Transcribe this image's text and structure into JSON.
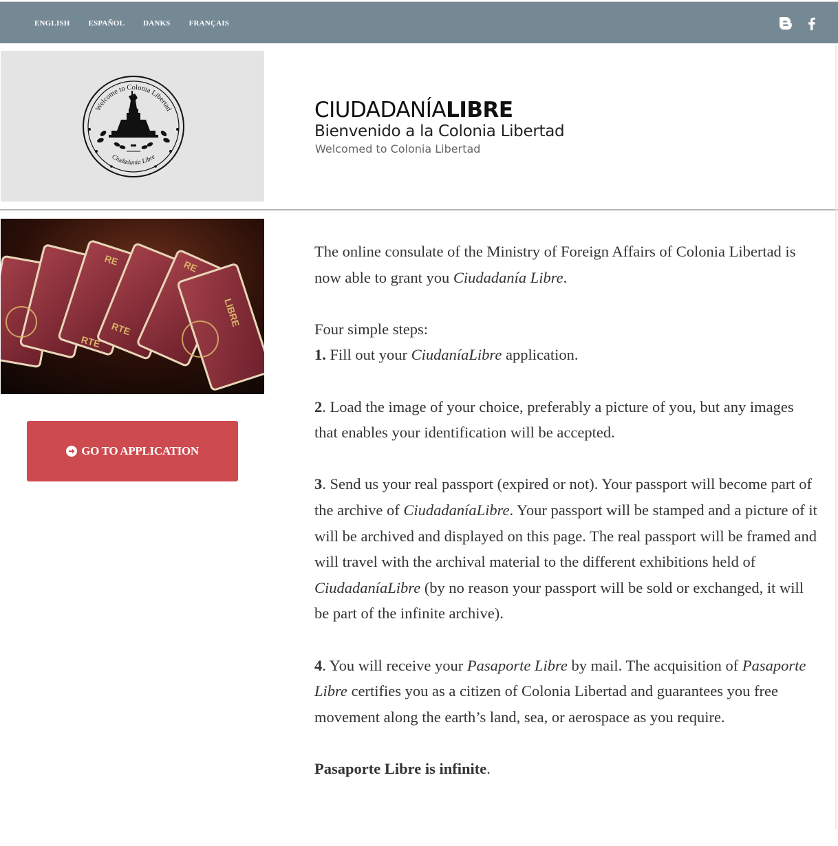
{
  "topbar": {
    "languages": [
      {
        "label": "ENGLISH"
      },
      {
        "label": "ESPAÑOL"
      },
      {
        "label": "DANKS"
      },
      {
        "label": "FRANÇAIS"
      }
    ],
    "social": [
      "blogger-icon",
      "facebook-icon"
    ]
  },
  "header": {
    "title_light": "CIUDADANÍA",
    "title_bold": "LIBRE",
    "subtitle_es": "Bienvenido a la Colonia Libertad",
    "subtitle_en": "Welcomed to Colonia Libertad",
    "seal": {
      "top_text": "Welcome to Colonia Libertad",
      "bottom_text": "Ciudadanía Libre"
    }
  },
  "photo": {
    "labels": [
      "LIBRE",
      "RTE",
      "RTE",
      "RE",
      "RE"
    ]
  },
  "cta": {
    "label": "GO TO APPLICATION",
    "icon": "circle-arrow-right-icon"
  },
  "content": {
    "intro_text": "The online consulate of the Ministry of Foreign Affairs of Colonia Libertad  is now able to grant you ",
    "intro_em": "Ciudadanía Libre",
    "intro_end": ".",
    "steps_heading": "Four simple steps:",
    "step1": {
      "num": "1.",
      "before": " Fill out your ",
      "em": "CiudaníaLibre",
      "after": " application."
    },
    "step2": {
      "num": "2",
      "text": ". Load the image of your choice, preferably a picture of you, but any images that enables your identification will be accepted."
    },
    "step3": {
      "num": "3",
      "t1": ". Send us your real passport (expired or not). Your passport will become part of the archive of ",
      "em1": "CiudadaníaLibre",
      "t2": ". Your passport will be stamped and a picture of it will be archived and displayed on this page. The real passport will be framed and will travel with the archival material to the different exhibitions held of ",
      "em2": "CiudadaníaLibre",
      "t3": " (by no reason your passport will be sold or exchanged, it will be part of the infinite archive)."
    },
    "step4": {
      "num": "4",
      "t1": ". You will receive your ",
      "em1": "Pasaporte Libre",
      "t2": " by mail. The acquisition of ",
      "em2": "Pasaporte Libre",
      "t3": " certifies you as a citizen of Colonia Libertad and guarantees you free movement along the earth’s land, sea, or aerospace as you require."
    },
    "closing_bold": "Pasaporte Libre is infinite",
    "closing_end": "."
  }
}
